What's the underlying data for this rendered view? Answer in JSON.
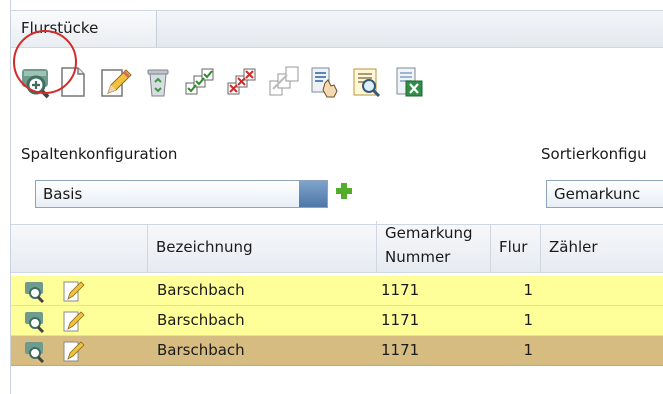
{
  "tab": {
    "title": "Flurstücke"
  },
  "toolbar": {
    "buttons": [
      "show-details-icon",
      "new-document-icon",
      "edit-icon",
      "recycle-bin-icon",
      "check-items-icon",
      "cross-items-icon",
      "copy-items-icon",
      "document-pointer-icon",
      "search-document-icon",
      "export-excel-icon"
    ]
  },
  "column_config": {
    "label": "Spaltenkonfiguration",
    "value": "Basis"
  },
  "sort_config": {
    "label": "Sortierkonfigu",
    "value": "Gemarkunc"
  },
  "table": {
    "headers": {
      "bezeichnung": "Bezeichnung",
      "gemarkung_line1": "Gemarkung",
      "gemarkung_line2": "Nummer",
      "flur": "Flur",
      "zaehler": "Zähler"
    },
    "rows": [
      {
        "bezeichnung": "Barschbach",
        "gemarkung": "1171",
        "flur": "1",
        "zaehler": ""
      },
      {
        "bezeichnung": "Barschbach",
        "gemarkung": "1171",
        "flur": "1",
        "zaehler": ""
      },
      {
        "bezeichnung": "Barschbach",
        "gemarkung": "1171",
        "flur": "1",
        "zaehler": ""
      }
    ],
    "selected_row": 2
  },
  "colors": {
    "row_highlight": "#ffff9a",
    "row_selected": "#d7bc82",
    "annotation_ring": "#d42a2a"
  }
}
